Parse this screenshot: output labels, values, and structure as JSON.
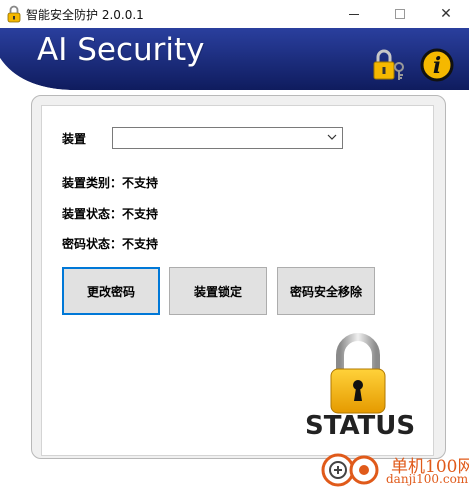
{
  "window": {
    "title": "智能安全防护 2.0.0.1",
    "minimize_glyph": "",
    "maximize_glyph": "",
    "close_glyph": "✕"
  },
  "banner": {
    "title": "AI Security"
  },
  "form": {
    "device_label": "装置",
    "device_select_value": "",
    "device_type": "装置类别：不支持",
    "device_status": "装置状态：不支持",
    "password_status": "密码状态：不支持"
  },
  "buttons": {
    "change_password": "更改密码",
    "lock_device": "装置锁定",
    "remove_password": "密码安全移除"
  },
  "status": {
    "label": "STATUS"
  },
  "watermark": {
    "line1": "单机100网",
    "line2": "danji100.com"
  },
  "colors": {
    "banner_blue": "#1c2f86",
    "accent": "#0078d7",
    "lock_gold": "#f5b800"
  }
}
